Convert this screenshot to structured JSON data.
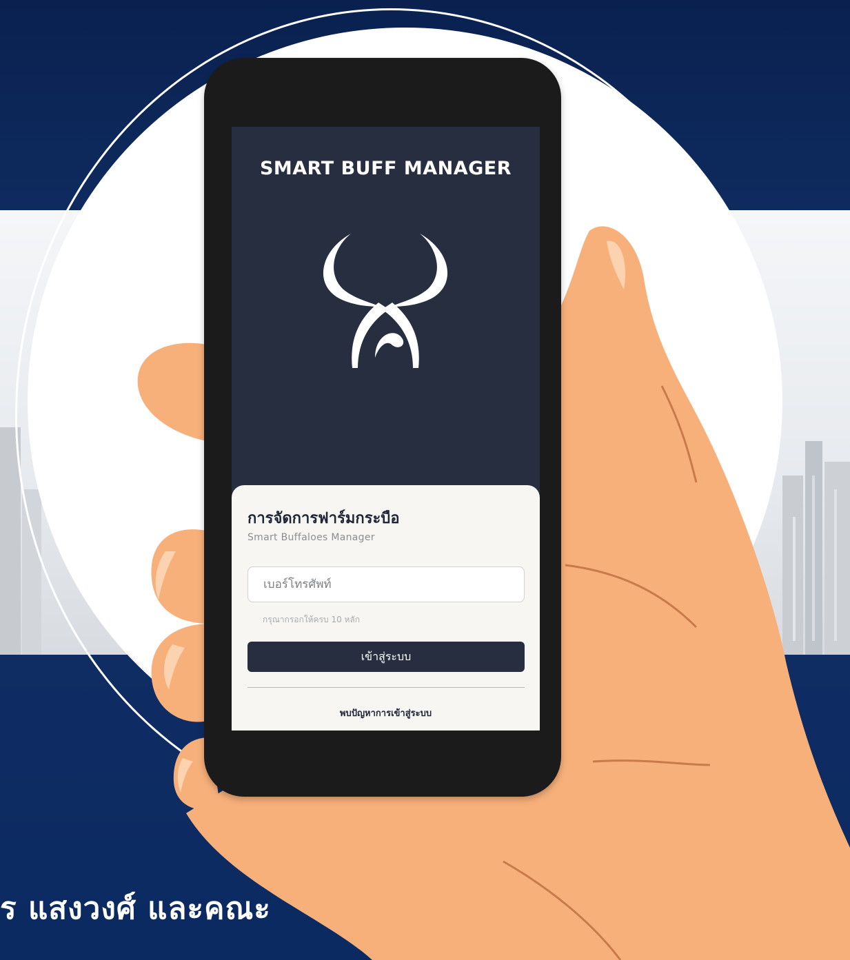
{
  "app": {
    "title": "SMART BUFF MANAGER",
    "logo_icon": "buffalo-horns-logo"
  },
  "login_card": {
    "title": "การจัดการฟาร์มกระบือ",
    "subtitle": "Smart Buffaloes Manager",
    "phone_placeholder": "เบอร์โทรศัพท์",
    "hint": "กรุณากรอกให้ครบ 10 หลัก",
    "login_button": "เข้าสู่ระบบ",
    "help_link": "พบปัญหาการเข้าสู่ระบบ"
  },
  "poster": {
    "footer_text": "ร แสงวงศ์ และคณะ"
  },
  "colors": {
    "background_navy": "#0d2a5c",
    "app_dark": "#262e40",
    "card_bg": "#f7f6f3",
    "hand_skin": "#f8b07a"
  }
}
